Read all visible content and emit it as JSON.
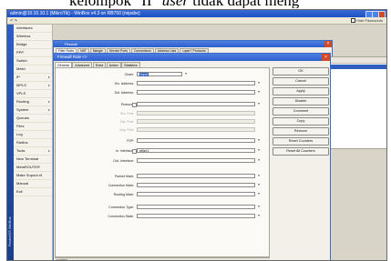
{
  "document": {
    "text_prefix": "kelompok \"II\" ",
    "text_italic": "user",
    "text_suffix": " tidak dapat meng"
  },
  "app": {
    "title": "admin@10.10.10.1 (MikroTik) - WinBox v4.3 on RB750 (mipsbe)",
    "safe_mode_label": "Hide Passwords",
    "side_brand": "RouterOS WinBox",
    "nav": "↶ ↷"
  },
  "menu": {
    "items": [
      {
        "label": "Interfaces",
        "arrow": ""
      },
      {
        "label": "Wireless",
        "arrow": ""
      },
      {
        "label": "Bridge",
        "arrow": ""
      },
      {
        "label": "PPP",
        "arrow": ""
      },
      {
        "label": "Switch",
        "arrow": ""
      },
      {
        "label": "Mesh",
        "arrow": ""
      },
      {
        "label": "IP",
        "arrow": "▸"
      },
      {
        "label": "MPLS",
        "arrow": "▸"
      },
      {
        "label": "VPLS",
        "arrow": ""
      },
      {
        "label": "Routing",
        "arrow": "▸"
      },
      {
        "label": "System",
        "arrow": "▸"
      },
      {
        "label": "Queues",
        "arrow": ""
      },
      {
        "label": "Files",
        "arrow": ""
      },
      {
        "label": "Log",
        "arrow": ""
      },
      {
        "label": "Radius",
        "arrow": ""
      },
      {
        "label": "Tools",
        "arrow": "▸"
      },
      {
        "label": "New Terminal",
        "arrow": ""
      },
      {
        "label": "MetaROUTER",
        "arrow": ""
      },
      {
        "label": "Make Supout.rif",
        "arrow": ""
      },
      {
        "label": "Manual",
        "arrow": ""
      },
      {
        "label": "Exit",
        "arrow": ""
      }
    ]
  },
  "firewall": {
    "title": "Firewall",
    "tabs": [
      "Filter Rules",
      "NAT",
      "Mangle",
      "Service Ports",
      "Connections",
      "Address Lists",
      "Layer7 Protocols"
    ]
  },
  "rule": {
    "title": "Firewall Rule <>",
    "tabs": [
      "General",
      "Advanced",
      "Extra",
      "Action",
      "Statistics"
    ],
    "active_tab": "General",
    "fields": [
      {
        "label": "Chain:",
        "value": "input",
        "selected": true,
        "disabled": false,
        "short": true,
        "check": false
      },
      {
        "label": "Src. Address:",
        "value": "",
        "disabled": false,
        "short": false,
        "check": false
      },
      {
        "label": "Dst. Address:",
        "value": "",
        "disabled": false,
        "short": false,
        "check": false
      },
      {
        "label": "Protocol:",
        "value": "",
        "disabled": false,
        "short": false,
        "check": true
      },
      {
        "label": "Src. Port:",
        "value": "",
        "disabled": true,
        "short": false,
        "check": false
      },
      {
        "label": "Dst. Port:",
        "value": "",
        "disabled": true,
        "short": false,
        "check": false
      },
      {
        "label": "Any. Port:",
        "value": "",
        "disabled": true,
        "short": false,
        "check": false
      },
      {
        "label": "P2P:",
        "value": "",
        "disabled": false,
        "short": false,
        "check": false
      },
      {
        "label": "In. Interface:",
        "value": "ether1",
        "disabled": false,
        "short": false,
        "check": true
      },
      {
        "label": "Out. Interface:",
        "value": "",
        "disabled": false,
        "short": false,
        "check": false
      },
      {
        "label": "Packet Mark:",
        "value": "",
        "disabled": false,
        "short": false,
        "check": false
      },
      {
        "label": "Connection Mark:",
        "value": "",
        "disabled": false,
        "short": false,
        "check": false
      },
      {
        "label": "Routing Mark:",
        "value": "",
        "disabled": false,
        "short": false,
        "check": false
      },
      {
        "label": "Connection Type:",
        "value": "",
        "disabled": false,
        "short": false,
        "check": false
      },
      {
        "label": "Connection State:",
        "value": "",
        "disabled": false,
        "short": false,
        "check": false
      }
    ],
    "buttons": [
      "OK",
      "Cancel",
      "Apply",
      "Disable",
      "Comment",
      "Copy",
      "Remove",
      "Reset Counters",
      "Reset All Counters"
    ],
    "status": "enabled"
  },
  "right_panel": {
    "header": "Find"
  }
}
